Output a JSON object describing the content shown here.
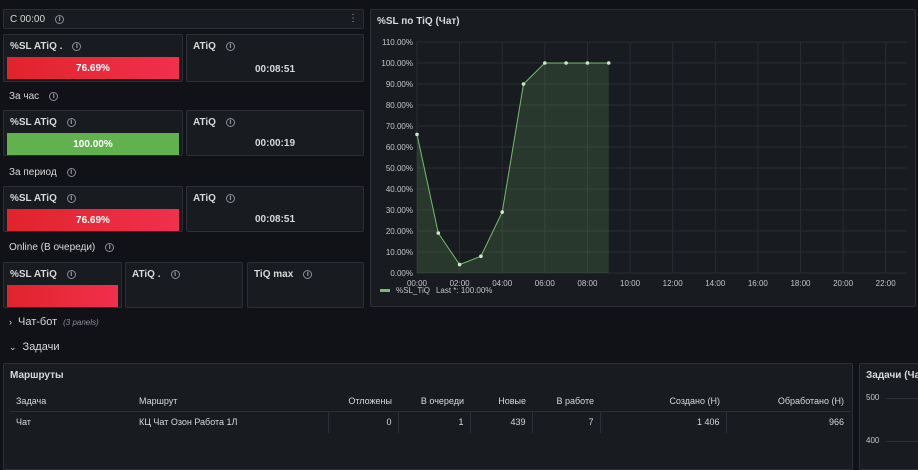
{
  "top_row": {
    "title": "С 00:00"
  },
  "rows": [
    {
      "label": "",
      "sl_title": "%SL ATiQ .",
      "sl_value": "76.69%",
      "sl_color": "red",
      "atiq_title": "ATiQ",
      "atiq_value": "00:08:51"
    },
    {
      "label": "За час",
      "sl_title": "%SL ATiQ",
      "sl_value": "100.00%",
      "sl_color": "green",
      "atiq_title": "ATiQ",
      "atiq_value": "00:00:19"
    },
    {
      "label": "За период",
      "sl_title": "%SL ATiQ",
      "sl_value": "76.69%",
      "sl_color": "red",
      "atiq_title": "ATiQ",
      "atiq_value": "00:08:51"
    }
  ],
  "online": {
    "label": "Online (В очереди)",
    "sl_title": "%SL ATiQ",
    "atiq_title": "ATiQ .",
    "tiq_title": "TiQ max"
  },
  "chart_panel": {
    "title": "%SL по TiQ (Чат)",
    "legend_name": "%SL_TiQ",
    "legend_last": "Last *: 100.00%"
  },
  "chart_data": {
    "type": "area",
    "title": "%SL по TiQ (Чат)",
    "y_ticks": [
      "0.00%",
      "10.00%",
      "20.00%",
      "30.00%",
      "40.00%",
      "50.00%",
      "60.00%",
      "70.00%",
      "80.00%",
      "90.00%",
      "100.00%",
      "110.00%"
    ],
    "x_ticks": [
      "00:00",
      "02:00",
      "04:00",
      "06:00",
      "08:00",
      "10:00",
      "12:00",
      "14:00",
      "16:00",
      "18:00",
      "20:00",
      "22:00"
    ],
    "ylim": [
      0,
      110
    ],
    "xlim_hours": [
      0,
      23
    ],
    "series": [
      {
        "name": "%SL_TiQ",
        "color": "#73bf69",
        "x": [
          "00:00",
          "01:00",
          "02:00",
          "03:00",
          "04:00",
          "05:00",
          "06:00",
          "07:00",
          "08:00",
          "09:00"
        ],
        "x_hours": [
          0,
          1,
          2,
          3,
          4,
          5,
          6,
          7,
          8,
          9
        ],
        "values": [
          66,
          19,
          4,
          8,
          29,
          90,
          100,
          100,
          100,
          100
        ]
      }
    ]
  },
  "sections": {
    "chatbot": {
      "name": "Чат-бот",
      "sub": "(3 panels)"
    },
    "tasks": {
      "name": "Задачи"
    }
  },
  "routes_panel": {
    "title": "Маршруты",
    "columns": [
      "Задача",
      "Маршрут",
      "Отложены",
      "В очереди",
      "Новые",
      "В работе",
      "Создано (Н)",
      "Обработано (Н)"
    ],
    "rows": [
      [
        "Чат",
        "КЦ Чат Озон Работа 1Л",
        "0",
        "1",
        "439",
        "7",
        "1 406",
        "966"
      ]
    ]
  },
  "tasks_chart": {
    "title": "Задачи (Ча",
    "y_ticks": [
      "500",
      "400"
    ]
  }
}
